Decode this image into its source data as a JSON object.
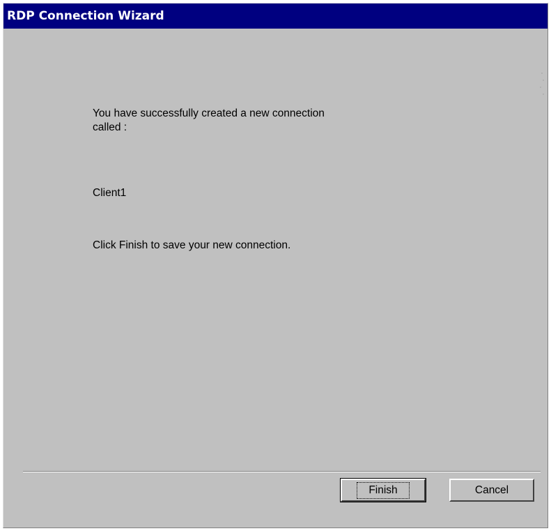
{
  "window": {
    "title": "RDP Connection Wizard"
  },
  "content": {
    "success_message": "You have successfully created a new connection called :",
    "connection_name": "Client1",
    "finish_hint": "Click Finish to save your new connection."
  },
  "buttons": {
    "finish_label": "Finish",
    "cancel_label": "Cancel"
  },
  "colors": {
    "titlebar": "#000080",
    "dialog_background": "#c0c0c0"
  }
}
